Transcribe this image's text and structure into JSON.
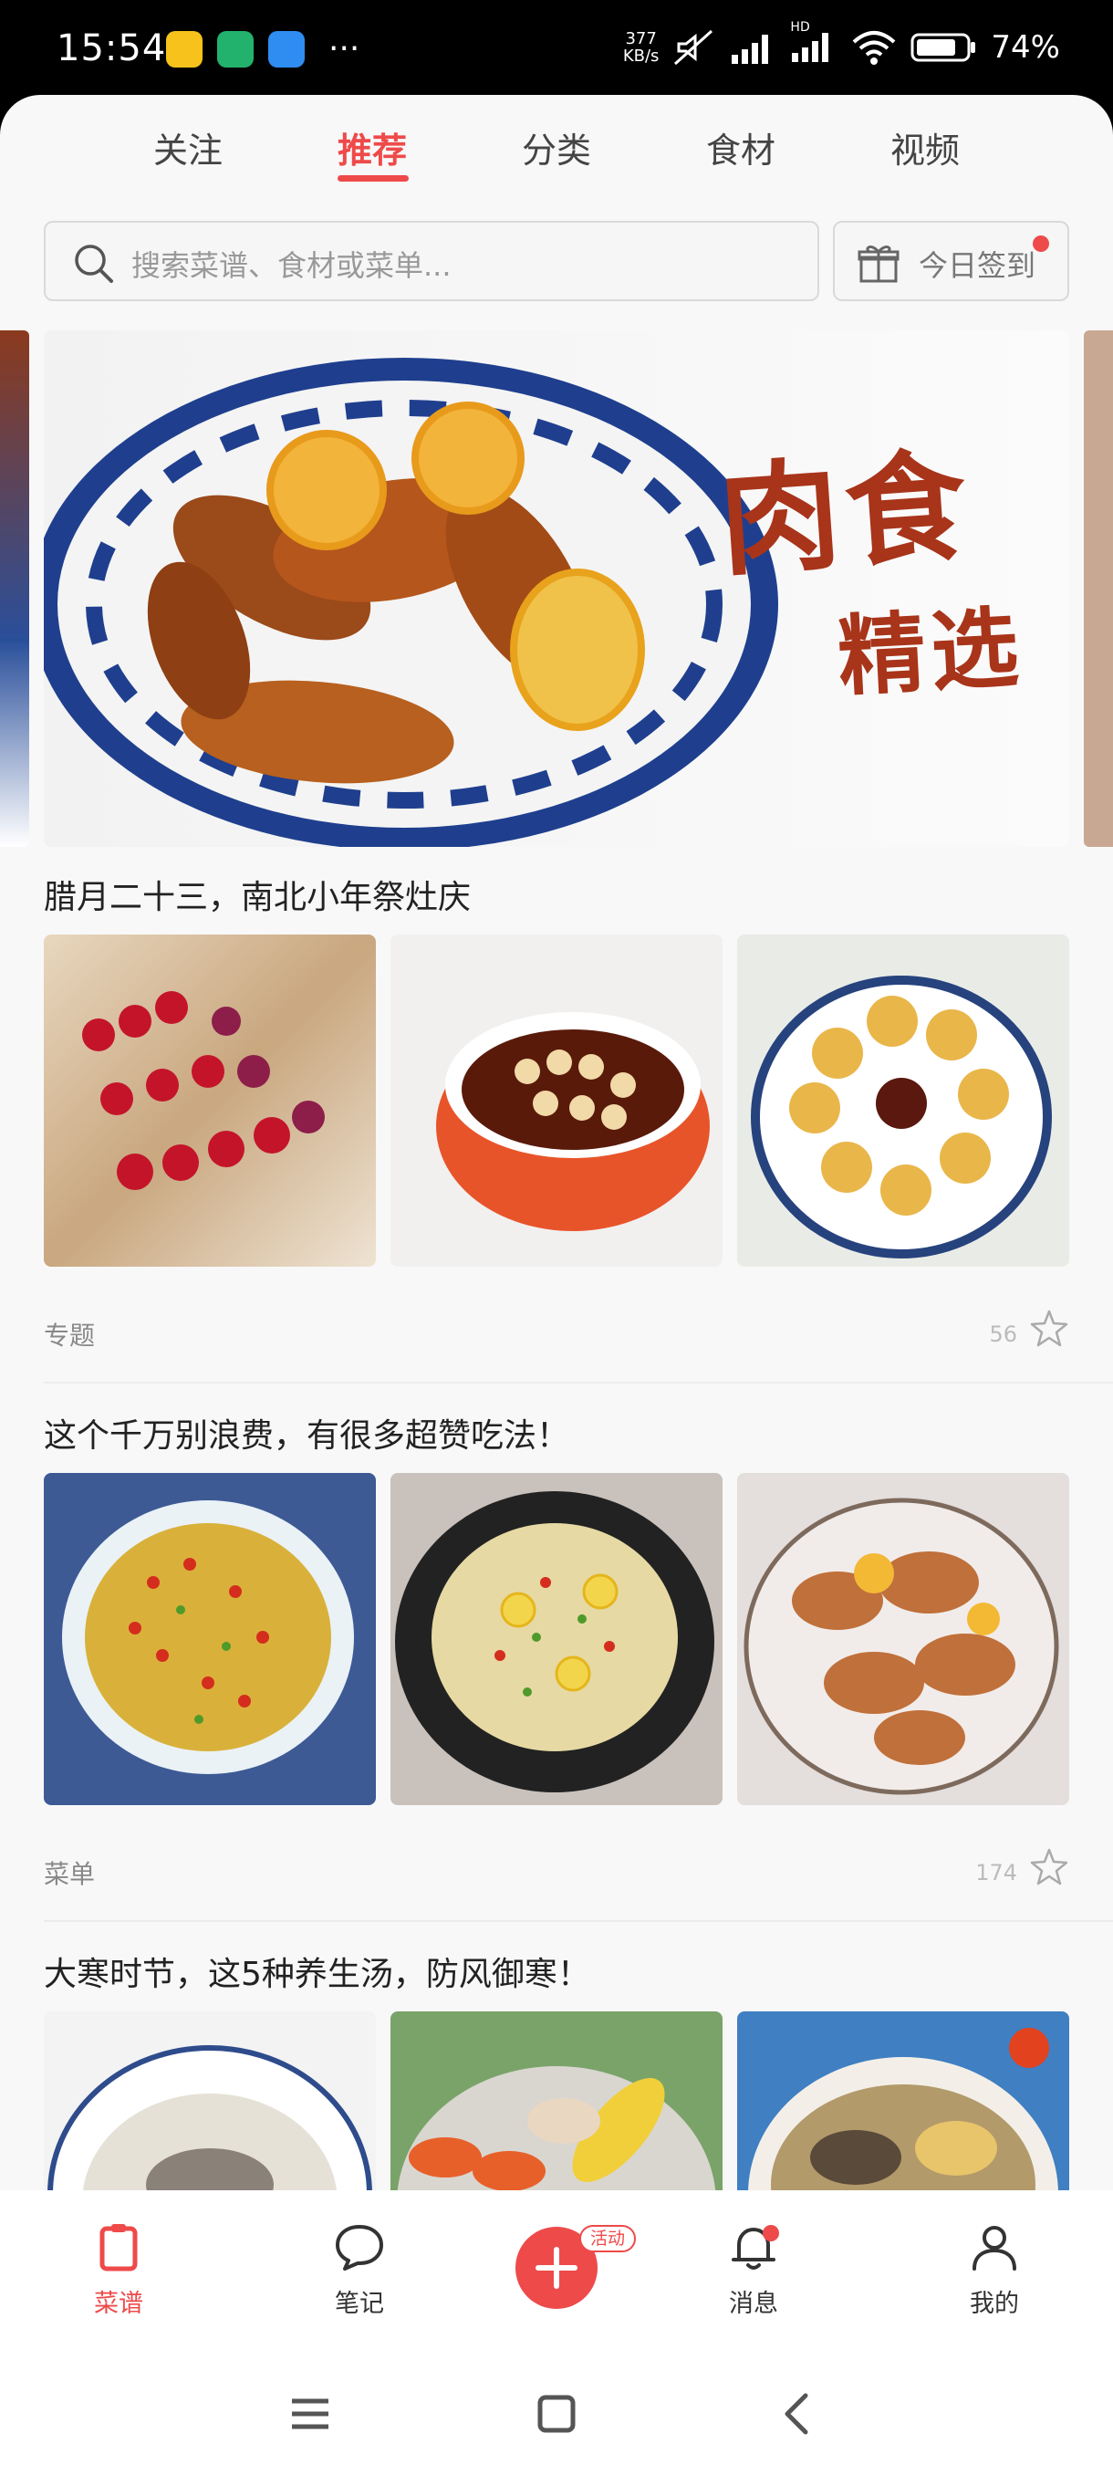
{
  "status_bar": {
    "time": "15:54",
    "net_speed_value": "377",
    "net_speed_unit": "KB/s",
    "network_badge": "HD",
    "battery": "74%",
    "icons": [
      "app-notification-icons",
      "mute-icon",
      "signal-icon",
      "wifi-icon",
      "battery-icon"
    ]
  },
  "tabs": [
    {
      "label": "关注"
    },
    {
      "label": "推荐"
    },
    {
      "label": "分类"
    },
    {
      "label": "食材"
    },
    {
      "label": "视频"
    }
  ],
  "active_tab": "推荐",
  "search": {
    "placeholder": "搜索菜谱、食材或菜单..."
  },
  "checkin": {
    "label": "今日签到"
  },
  "banner": {
    "title": "肉食",
    "subtitle": "精选"
  },
  "sections": [
    {
      "title": "腊月二十三，南北小年祭灶庆",
      "tag": "专题",
      "count": "56"
    },
    {
      "title": "这个千万别浪费，有很多超赞吃法！",
      "tag": "菜单",
      "count": "174"
    },
    {
      "title": "大寒时节，这5种养生汤，防风御寒！"
    }
  ],
  "bottom_nav": [
    {
      "label": "菜谱",
      "icon": "recipe-icon"
    },
    {
      "label": "笔记",
      "icon": "note-chat-icon"
    },
    {
      "label": "",
      "icon": "plus-icon"
    },
    {
      "label": "消息",
      "icon": "bell-icon"
    },
    {
      "label": "我的",
      "icon": "profile-icon"
    }
  ],
  "activity_badge": "活动",
  "colors": {
    "accent": "#ee4a4a",
    "background": "#f8f8f8"
  }
}
